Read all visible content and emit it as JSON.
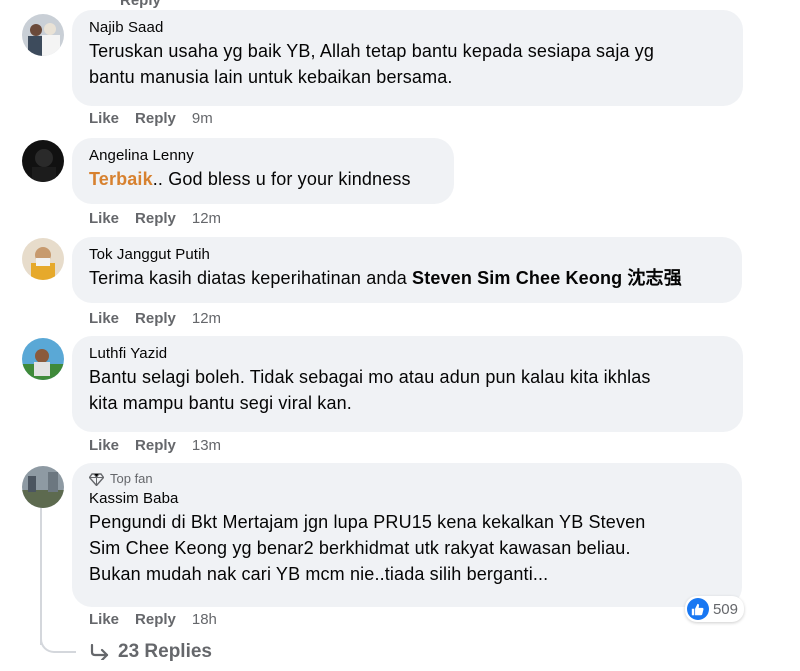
{
  "top_fragment": "Reply",
  "comments": [
    {
      "author": "Najib Saad",
      "lines": [
        "Teruskan usaha yg baik YB, Allah tetap bantu kepada sesiapa saja yg",
        "bantu manusia lain untuk kebaikan bersama."
      ],
      "like_label": "Like",
      "reply_label": "Reply",
      "time": "9m"
    },
    {
      "author": "Angelina Lenny",
      "highlight": "Terbaik",
      "rest": ".. God bless u for your kindness",
      "like_label": "Like",
      "reply_label": "Reply",
      "time": "12m"
    },
    {
      "author": "Tok Janggut Putih",
      "prefix": "Terima kasih diatas keperihatinan anda ",
      "mention": "Steven Sim Chee Keong 沈志强",
      "like_label": "Like",
      "reply_label": "Reply",
      "time": "12m"
    },
    {
      "author": "Luthfi Yazid",
      "lines": [
        "Bantu selagi boleh. Tidak sebagai mo atau adun pun kalau kita ikhlas",
        "kita mampu bantu segi viral kan."
      ],
      "like_label": "Like",
      "reply_label": "Reply",
      "time": "13m"
    },
    {
      "badge": "Top fan",
      "author": "Kassim Baba",
      "lines": [
        "Pengundi di Bkt Mertajam jgn lupa PRU15 kena kekalkan YB Steven",
        "Sim Chee Keong yg benar2 berkhidmat utk rakyat kawasan beliau.",
        "Bukan mudah nak cari YB mcm nie..tiada silih berganti..."
      ],
      "like_label": "Like",
      "reply_label": "Reply",
      "time": "18h",
      "reaction_count": "509"
    }
  ],
  "replies_label": "23 Replies",
  "colors": {
    "bubble": "#f0f2f5",
    "meta": "#65676b",
    "highlight": "#d7812f",
    "like_blue": "#1877f2"
  }
}
